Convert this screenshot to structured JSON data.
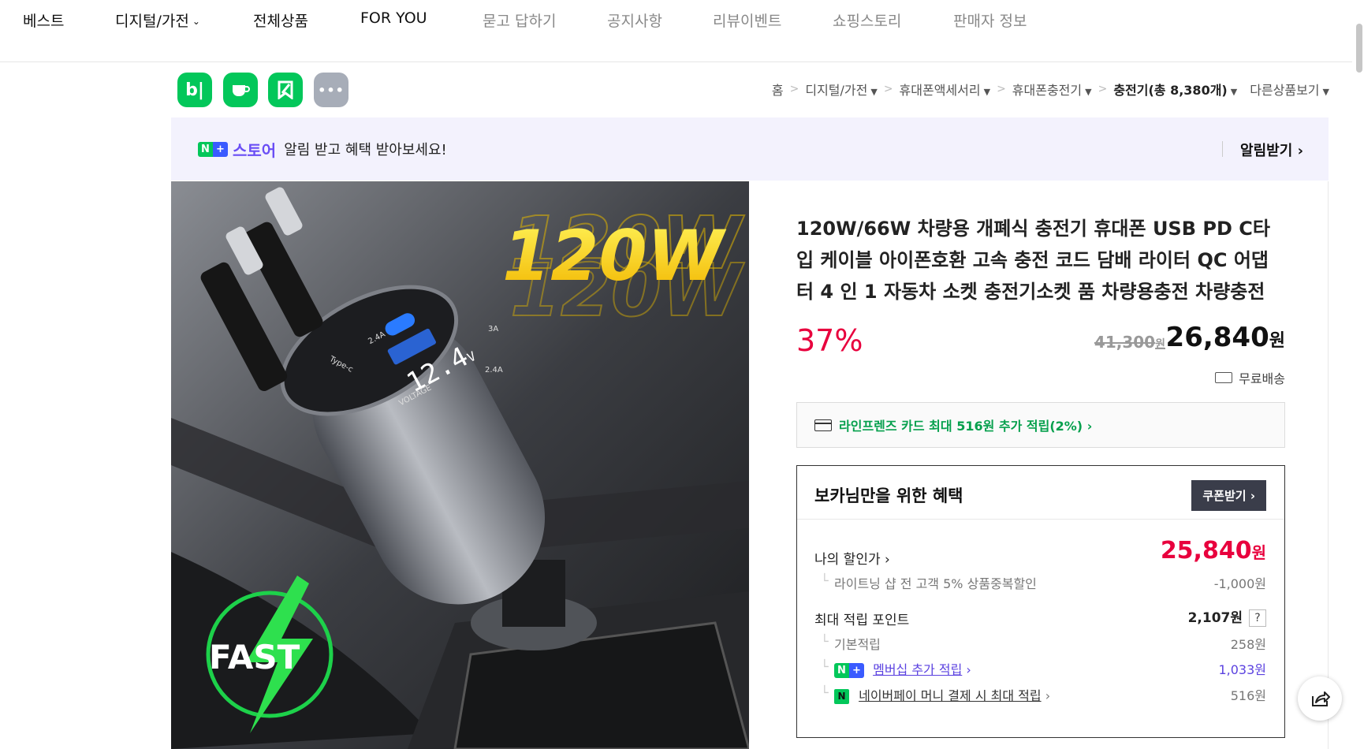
{
  "topnav": {
    "items": [
      {
        "label": "베스트"
      },
      {
        "label": "디지털/가전"
      },
      {
        "label": "전체상품"
      },
      {
        "label": "FOR YOU"
      },
      {
        "label": "묻고 답하기"
      },
      {
        "label": "공지사항"
      },
      {
        "label": "리뷰이벤트"
      },
      {
        "label": "쇼핑스토리"
      },
      {
        "label": "판매자 정보"
      }
    ]
  },
  "apps": {
    "blog": "b|",
    "more": "•••"
  },
  "breadcrumb": {
    "home": "홈",
    "c1": "디지털/가전",
    "c2": "휴대폰액세서리",
    "c3": "휴대폰충전기",
    "c4": "충전기(총 8,380개)",
    "other": "다른상품보기"
  },
  "notify": {
    "brand": "스토어",
    "text": "알림 받고 혜택 받아보세요!",
    "button": "알림받기"
  },
  "image": {
    "wattage": "120W",
    "display": "12.4",
    "display_unit": "V",
    "voltage_label": "VOLTAGE",
    "port_3a": "3A",
    "port_24a": "2.4A",
    "typec": "Type-c",
    "fast": "FAST"
  },
  "product": {
    "title": "120W/66W 차량용 개폐식 충전기 휴대폰 USB PD C타입 케이블 아이폰호환 고속 충전 코드 담배 라이터 QC 어댑터 4 인 1 자동차 소켓 충전기소켓 품 차량용충전 차량충전",
    "discount": "37%",
    "original_price": "41,300",
    "original_unit": "원",
    "sale_price": "26,840",
    "sale_unit": "원",
    "shipping": "무료배송",
    "card_benefit": "라인프렌즈 카드 최대 516원 추가 적립(2%)"
  },
  "benefit": {
    "title": "보카님만을 위한 혜택",
    "coupon_button": "쿠폰받기",
    "my_price_label": "나의 할인가",
    "my_price": "25,840",
    "my_price_unit": "원",
    "discount_note": "라이트닝 샵 전 고객 5% 상품중복할인",
    "discount_amount": "-1,000원",
    "max_points_label": "최대 적립 포인트",
    "max_points": "2,107원",
    "help": "?",
    "base_label": "기본적립",
    "base_value": "258원",
    "membership_label": "멤버십 추가 적립",
    "membership_value": "1,033원",
    "npay_label": "네이버페이 머니 결제 시 최대 적립",
    "npay_value": "516원"
  },
  "colors": {
    "naver_green": "#03c75a",
    "discount_red": "#e8003d",
    "store_purple": "#6a4ef5",
    "notify_bg": "#f3f2fd"
  }
}
